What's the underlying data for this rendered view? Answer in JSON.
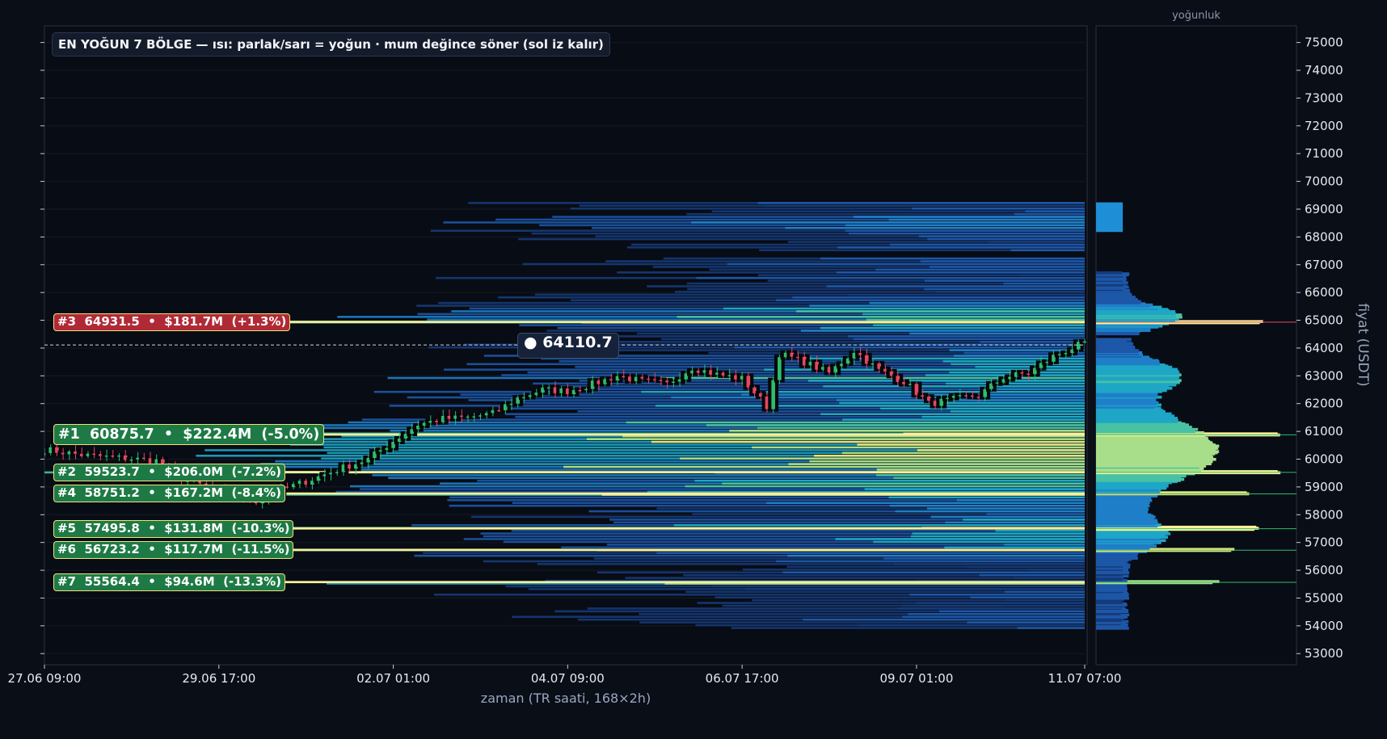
{
  "chart_data": {
    "type": "heatmap",
    "title": "EN YOĞUN 7 BÖLGE — ısı: parlak/sarı = yoğun · mum değince söner (sol iz kalır)",
    "xlabel": "zaman (TR saati, 168×2h)",
    "ylabel": "fiyat (USDT)",
    "profile_title": "yoğunluk",
    "ylim": [
      52600,
      75600
    ],
    "y_ticks": [
      "53000",
      "54000",
      "55000",
      "56000",
      "57000",
      "58000",
      "59000",
      "60000",
      "61000",
      "62000",
      "63000",
      "64000",
      "65000",
      "66000",
      "67000",
      "68000",
      "69000",
      "70000",
      "71000",
      "72000",
      "73000",
      "74000",
      "75000"
    ],
    "x_tick_labels": [
      "27.06 09:00",
      "29.06 17:00",
      "02.07 01:00",
      "04.07 09:00",
      "06.07 17:00",
      "09.07 01:00",
      "11.07 07:00"
    ],
    "x_tick_index": [
      0,
      28,
      56,
      84,
      112,
      140,
      167
    ],
    "current_price": "● 64110.7",
    "current_price_value": 64110.7,
    "zones": [
      {
        "text": "#1  60875.7  •  $222.4M  (-5.0%)",
        "price": 60875.7,
        "color": "#1e7a45",
        "big": true
      },
      {
        "text": "#2  59523.7  •  $206.0M  (-7.2%)",
        "price": 59523.7,
        "color": "#1e7a45"
      },
      {
        "text": "#3  64931.5  •  $181.7M  (+1.3%)",
        "price": 64931.5,
        "color": "#b02a36"
      },
      {
        "text": "#4  58751.2  •  $167.2M  (-8.4%)",
        "price": 58751.2,
        "color": "#1e7a45"
      },
      {
        "text": "#5  57495.8  •  $131.8M  (-10.3%)",
        "price": 57495.8,
        "color": "#1e7a45"
      },
      {
        "text": "#6  56723.2  •  $117.7M  (-11.5%)",
        "price": 56723.2,
        "color": "#1e7a45"
      },
      {
        "text": "#7  55564.4  •  $94.6M  (-13.3%)",
        "price": 55564.4,
        "color": "#1e7a45"
      }
    ],
    "price_path": [
      [
        0,
        60350
      ],
      [
        6,
        60150
      ],
      [
        12,
        60050
      ],
      [
        18,
        59950
      ],
      [
        22,
        59300
      ],
      [
        26,
        59000
      ],
      [
        30,
        58700
      ],
      [
        34,
        58500
      ],
      [
        38,
        58900
      ],
      [
        42,
        59200
      ],
      [
        48,
        59700
      ],
      [
        52,
        60000
      ],
      [
        56,
        60650
      ],
      [
        60,
        61250
      ],
      [
        64,
        61450
      ],
      [
        68,
        61500
      ],
      [
        72,
        61650
      ],
      [
        76,
        62200
      ],
      [
        80,
        62500
      ],
      [
        84,
        62450
      ],
      [
        88,
        62700
      ],
      [
        92,
        63000
      ],
      [
        96,
        62800
      ],
      [
        100,
        62700
      ],
      [
        104,
        63300
      ],
      [
        108,
        63050
      ],
      [
        112,
        62900
      ],
      [
        116,
        61900
      ],
      [
        118,
        63800
      ],
      [
        122,
        63500
      ],
      [
        126,
        63100
      ],
      [
        130,
        63900
      ],
      [
        134,
        63200
      ],
      [
        138,
        62800
      ],
      [
        142,
        62000
      ],
      [
        146,
        62150
      ],
      [
        150,
        62300
      ],
      [
        154,
        62950
      ],
      [
        158,
        63100
      ],
      [
        162,
        63700
      ],
      [
        166,
        64100
      ],
      [
        167,
        64110
      ]
    ]
  }
}
